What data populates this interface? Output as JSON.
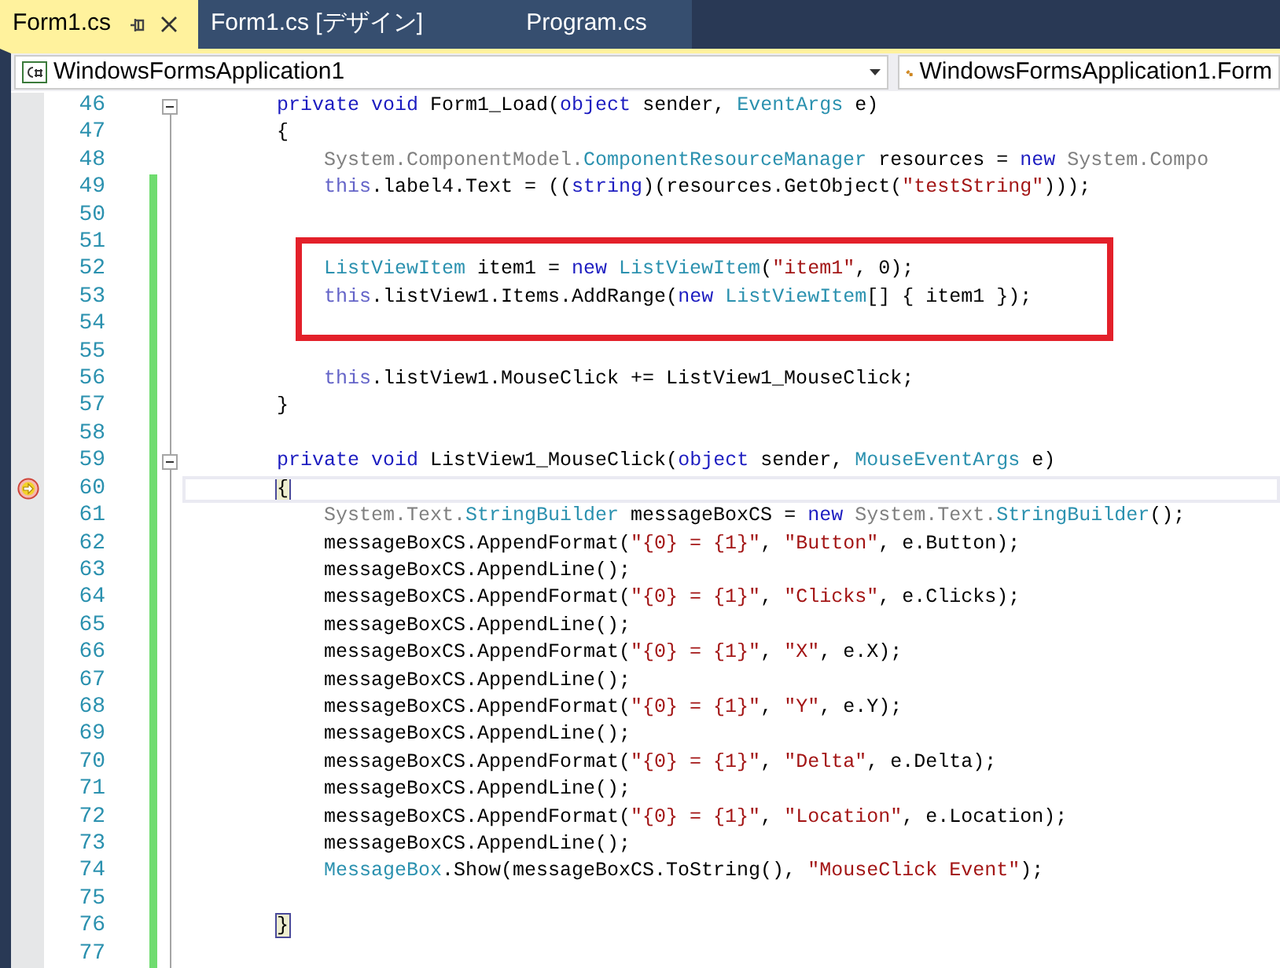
{
  "tabs": [
    {
      "label": "Form1.cs",
      "selected": true
    },
    {
      "label": "Form1.cs [デザイン]",
      "selected": false
    },
    {
      "label": "Program.cs",
      "selected": false
    }
  ],
  "navigation_bar": {
    "project": "WindowsFormsApplication1",
    "type": "WindowsFormsApplication1.Form"
  },
  "code_lines": [
    {
      "number": "46",
      "changed": false,
      "fold_toggle": true,
      "current": false,
      "highlighted": false,
      "kind": "member",
      "tokens": [
        {
          "kind": "keyword",
          "text": "private"
        },
        {
          "kind": "keyword",
          "text": " void"
        },
        {
          "kind": "text",
          "text": " Form1_Load("
        },
        {
          "kind": "keyword",
          "text": "object"
        },
        {
          "kind": "text",
          "text": " sender, "
        },
        {
          "kind": "type",
          "text": "EventArgs"
        },
        {
          "kind": "text",
          "text": " e)"
        }
      ]
    },
    {
      "number": "47",
      "changed": false,
      "fold_toggle": false,
      "current": false,
      "highlighted": false,
      "kind": "member",
      "tokens": [
        {
          "kind": "text",
          "text": "{"
        }
      ]
    },
    {
      "number": "48",
      "changed": false,
      "fold_toggle": false,
      "current": false,
      "highlighted": false,
      "kind": "statement",
      "tokens": [
        {
          "kind": "faded",
          "text": "System.ComponentModel."
        },
        {
          "kind": "type",
          "text": "ComponentResourceManager"
        },
        {
          "kind": "text",
          "text": " resources = "
        },
        {
          "kind": "keyword",
          "text": "new"
        },
        {
          "kind": "faded",
          "text": " System.Compo"
        }
      ]
    },
    {
      "number": "49",
      "changed": true,
      "fold_toggle": false,
      "current": false,
      "highlighted": false,
      "kind": "statement",
      "tokens": [
        {
          "kind": "this",
          "text": "this"
        },
        {
          "kind": "text",
          "text": ".label4.Text = (("
        },
        {
          "kind": "keyword",
          "text": "string"
        },
        {
          "kind": "text",
          "text": ")(resources.GetObject("
        },
        {
          "kind": "string",
          "text": "\"testString\""
        },
        {
          "kind": "text",
          "text": ")));"
        }
      ]
    },
    {
      "number": "50",
      "changed": true,
      "fold_toggle": false,
      "current": false,
      "highlighted": false
    },
    {
      "number": "51",
      "changed": true,
      "fold_toggle": false,
      "current": false,
      "highlighted": true
    },
    {
      "number": "52",
      "changed": true,
      "fold_toggle": false,
      "current": false,
      "highlighted": true,
      "kind": "statement",
      "tokens": [
        {
          "kind": "type",
          "text": "ListViewItem"
        },
        {
          "kind": "text",
          "text": " item1 = "
        },
        {
          "kind": "keyword",
          "text": "new"
        },
        {
          "kind": "type",
          "text": " ListViewItem"
        },
        {
          "kind": "text",
          "text": "("
        },
        {
          "kind": "string",
          "text": "\"item1\""
        },
        {
          "kind": "text",
          "text": ", 0);"
        }
      ]
    },
    {
      "number": "53",
      "changed": true,
      "fold_toggle": false,
      "current": false,
      "highlighted": true,
      "kind": "statement",
      "tokens": [
        {
          "kind": "this",
          "text": "this"
        },
        {
          "kind": "text",
          "text": ".listView1.Items.AddRange("
        },
        {
          "kind": "keyword",
          "text": "new"
        },
        {
          "kind": "type",
          "text": " ListViewItem"
        },
        {
          "kind": "text",
          "text": "[] { item1 });"
        }
      ]
    },
    {
      "number": "54",
      "changed": true,
      "fold_toggle": false,
      "current": false,
      "highlighted": true
    },
    {
      "number": "55",
      "changed": true,
      "fold_toggle": false,
      "current": false,
      "highlighted": false
    },
    {
      "number": "56",
      "changed": true,
      "fold_toggle": false,
      "current": false,
      "highlighted": false,
      "kind": "statement",
      "tokens": [
        {
          "kind": "this",
          "text": "this"
        },
        {
          "kind": "text",
          "text": ".listView1.MouseClick += ListView1_MouseClick;"
        }
      ]
    },
    {
      "number": "57",
      "changed": true,
      "fold_toggle": false,
      "current": false,
      "highlighted": false,
      "kind": "member",
      "tokens": [
        {
          "kind": "text",
          "text": "}"
        }
      ]
    },
    {
      "number": "58",
      "changed": true,
      "fold_toggle": false,
      "current": false,
      "highlighted": false
    },
    {
      "number": "59",
      "changed": true,
      "fold_toggle": true,
      "current": false,
      "highlighted": false,
      "kind": "member",
      "tokens": [
        {
          "kind": "keyword",
          "text": "private"
        },
        {
          "kind": "keyword",
          "text": " void"
        },
        {
          "kind": "text",
          "text": " ListView1_MouseClick("
        },
        {
          "kind": "keyword",
          "text": "object"
        },
        {
          "kind": "text",
          "text": " sender, "
        },
        {
          "kind": "type",
          "text": "MouseEventArgs"
        },
        {
          "kind": "text",
          "text": " e)"
        }
      ]
    },
    {
      "number": "60",
      "changed": true,
      "fold_toggle": false,
      "current": true,
      "highlighted": false,
      "kind": "member",
      "tokens": [
        {
          "kind": "brace",
          "text": "{"
        }
      ]
    },
    {
      "number": "61",
      "changed": true,
      "fold_toggle": false,
      "current": false,
      "highlighted": false,
      "kind": "statement",
      "tokens": [
        {
          "kind": "faded",
          "text": "System.Text."
        },
        {
          "kind": "type",
          "text": "StringBuilder"
        },
        {
          "kind": "text",
          "text": " messageBoxCS = "
        },
        {
          "kind": "keyword",
          "text": "new"
        },
        {
          "kind": "faded",
          "text": " System.Text."
        },
        {
          "kind": "type",
          "text": "StringBuilder"
        },
        {
          "kind": "text",
          "text": "();"
        }
      ]
    },
    {
      "number": "62",
      "changed": true,
      "fold_toggle": false,
      "current": false,
      "highlighted": false,
      "kind": "statement",
      "tokens": [
        {
          "kind": "text",
          "text": "messageBoxCS.AppendFormat("
        },
        {
          "kind": "string",
          "text": "\"{0} = {1}\""
        },
        {
          "kind": "text",
          "text": ", "
        },
        {
          "kind": "string",
          "text": "\"Button\""
        },
        {
          "kind": "text",
          "text": ", e.Button);"
        }
      ]
    },
    {
      "number": "63",
      "changed": true,
      "fold_toggle": false,
      "current": false,
      "highlighted": false,
      "kind": "statement",
      "tokens": [
        {
          "kind": "text",
          "text": "messageBoxCS.AppendLine();"
        }
      ]
    },
    {
      "number": "64",
      "changed": true,
      "fold_toggle": false,
      "current": false,
      "highlighted": false,
      "kind": "statement",
      "tokens": [
        {
          "kind": "text",
          "text": "messageBoxCS.AppendFormat("
        },
        {
          "kind": "string",
          "text": "\"{0} = {1}\""
        },
        {
          "kind": "text",
          "text": ", "
        },
        {
          "kind": "string",
          "text": "\"Clicks\""
        },
        {
          "kind": "text",
          "text": ", e.Clicks);"
        }
      ]
    },
    {
      "number": "65",
      "changed": true,
      "fold_toggle": false,
      "current": false,
      "highlighted": false,
      "kind": "statement",
      "tokens": [
        {
          "kind": "text",
          "text": "messageBoxCS.AppendLine();"
        }
      ]
    },
    {
      "number": "66",
      "changed": true,
      "fold_toggle": false,
      "current": false,
      "highlighted": false,
      "kind": "statement",
      "tokens": [
        {
          "kind": "text",
          "text": "messageBoxCS.AppendFormat("
        },
        {
          "kind": "string",
          "text": "\"{0} = {1}\""
        },
        {
          "kind": "text",
          "text": ", "
        },
        {
          "kind": "string",
          "text": "\"X\""
        },
        {
          "kind": "text",
          "text": ", e.X);"
        }
      ]
    },
    {
      "number": "67",
      "changed": true,
      "fold_toggle": false,
      "current": false,
      "highlighted": false,
      "kind": "statement",
      "tokens": [
        {
          "kind": "text",
          "text": "messageBoxCS.AppendLine();"
        }
      ]
    },
    {
      "number": "68",
      "changed": true,
      "fold_toggle": false,
      "current": false,
      "highlighted": false,
      "kind": "statement",
      "tokens": [
        {
          "kind": "text",
          "text": "messageBoxCS.AppendFormat("
        },
        {
          "kind": "string",
          "text": "\"{0} = {1}\""
        },
        {
          "kind": "text",
          "text": ", "
        },
        {
          "kind": "string",
          "text": "\"Y\""
        },
        {
          "kind": "text",
          "text": ", e.Y);"
        }
      ]
    },
    {
      "number": "69",
      "changed": true,
      "fold_toggle": false,
      "current": false,
      "highlighted": false,
      "kind": "statement",
      "tokens": [
        {
          "kind": "text",
          "text": "messageBoxCS.AppendLine();"
        }
      ]
    },
    {
      "number": "70",
      "changed": true,
      "fold_toggle": false,
      "current": false,
      "highlighted": false,
      "kind": "statement",
      "tokens": [
        {
          "kind": "text",
          "text": "messageBoxCS.AppendFormat("
        },
        {
          "kind": "string",
          "text": "\"{0} = {1}\""
        },
        {
          "kind": "text",
          "text": ", "
        },
        {
          "kind": "string",
          "text": "\"Delta\""
        },
        {
          "kind": "text",
          "text": ", e.Delta);"
        }
      ]
    },
    {
      "number": "71",
      "changed": true,
      "fold_toggle": false,
      "current": false,
      "highlighted": false,
      "kind": "statement",
      "tokens": [
        {
          "kind": "text",
          "text": "messageBoxCS.AppendLine();"
        }
      ]
    },
    {
      "number": "72",
      "changed": true,
      "fold_toggle": false,
      "current": false,
      "highlighted": false,
      "kind": "statement",
      "tokens": [
        {
          "kind": "text",
          "text": "messageBoxCS.AppendFormat("
        },
        {
          "kind": "string",
          "text": "\"{0} = {1}\""
        },
        {
          "kind": "text",
          "text": ", "
        },
        {
          "kind": "string",
          "text": "\"Location\""
        },
        {
          "kind": "text",
          "text": ", e.Location);"
        }
      ]
    },
    {
      "number": "73",
      "changed": true,
      "fold_toggle": false,
      "current": false,
      "highlighted": false,
      "kind": "statement",
      "tokens": [
        {
          "kind": "text",
          "text": "messageBoxCS.AppendLine();"
        }
      ]
    },
    {
      "number": "74",
      "changed": true,
      "fold_toggle": false,
      "current": false,
      "highlighted": false,
      "kind": "statement",
      "tokens": [
        {
          "kind": "type",
          "text": "MessageBox"
        },
        {
          "kind": "text",
          "text": ".Show(messageBoxCS.ToString(), "
        },
        {
          "kind": "string",
          "text": "\"MouseClick Event\""
        },
        {
          "kind": "text",
          "text": ");"
        }
      ]
    },
    {
      "number": "75",
      "changed": true,
      "fold_toggle": false,
      "current": false,
      "highlighted": false
    },
    {
      "number": "76",
      "changed": true,
      "fold_toggle": false,
      "current": false,
      "highlighted": false,
      "kind": "member",
      "tokens": [
        {
          "kind": "brace",
          "text": "}"
        }
      ]
    },
    {
      "number": "77",
      "changed": true,
      "fold_toggle": false,
      "current": false,
      "highlighted": false
    }
  ]
}
